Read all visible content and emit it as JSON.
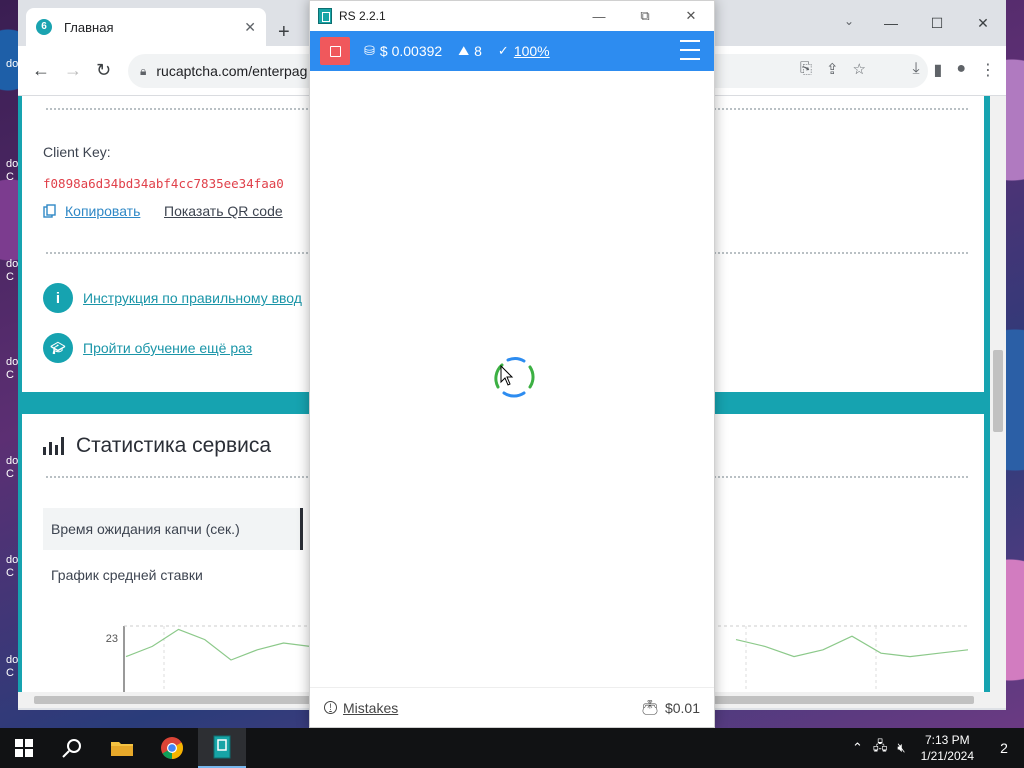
{
  "desktop": {
    "icons": [
      "do",
      "do C",
      "do C",
      "do C",
      "do C",
      "do C",
      "do C"
    ]
  },
  "browser": {
    "tab_title": "Главная",
    "new_tab_symbol": "+",
    "url": "rucaptcha.com/enterpag",
    "controls": {
      "minimize": "—",
      "maximize": "☐",
      "close": "✕"
    }
  },
  "page": {
    "client_key_label": "Client Key:",
    "client_key_value": "f0898a6d34bd34abf4cc7835ee34faa0",
    "copy_label": "Копировать",
    "qr_label": "Показать QR code",
    "instructions_link": "Инструкция по правильному ввод",
    "training_link": "Пройти обучение ещё раз",
    "stats_title": "Статистика сервиса",
    "wait_time_tab": "Время ожидания капчи (сек.)",
    "avg_bid_label": "График средней ставки",
    "chart_y_tick": "23"
  },
  "chart_data": {
    "type": "line",
    "ylabel": "",
    "y_ticks": [
      "23"
    ],
    "series": [
      {
        "values": [
          22.1,
          22.4,
          22.9,
          22.6,
          22.0,
          22.3,
          22.5,
          22.4,
          22.2
        ]
      },
      {
        "values": [
          22.6,
          22.4,
          22.1,
          22.3,
          22.7,
          22.2,
          22.1,
          22.2,
          22.3
        ]
      }
    ]
  },
  "rs_app": {
    "title": "RS 2.2.1",
    "balance": "$ 0.00392",
    "count": "8",
    "accuracy": "100%",
    "mistakes_label": "Mistakes",
    "wallet_value": "$0.01",
    "accent_color": "#2d8cf0",
    "stop_color": "#f0585c"
  },
  "taskbar": {
    "time": "7:13 PM",
    "date": "1/21/2024",
    "notifications": "2"
  }
}
